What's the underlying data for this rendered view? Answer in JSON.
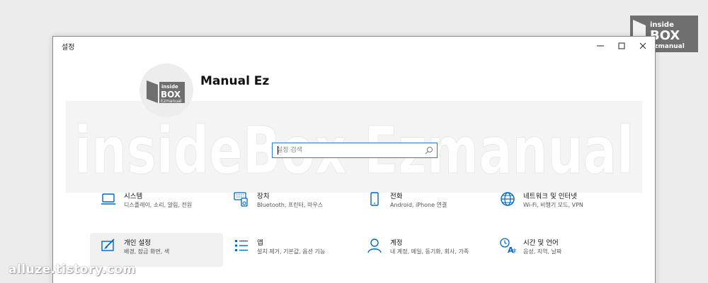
{
  "window": {
    "title": "설정",
    "minimize_glyph": "—",
    "maximize_glyph": "☐",
    "close_glyph": "✕"
  },
  "profile": {
    "name": "Manual Ez"
  },
  "search": {
    "placeholder": "설정 검색",
    "icon": "search-icon"
  },
  "watermark": {
    "band_text": "insideBox Ezmanual",
    "site": "alluze.tistory.com",
    "logo_lines": [
      "inside",
      "BOX",
      "Ezmanual"
    ]
  },
  "tiles": [
    {
      "label": "시스템",
      "desc": "디스플레이, 소리, 알림, 전원",
      "icon": "laptop-icon"
    },
    {
      "label": "장치",
      "desc": "Bluetooth, 프린터, 마우스",
      "icon": "keyboard-speaker-icon"
    },
    {
      "label": "전화",
      "desc": "Android, iPhone 연결",
      "icon": "phone-icon"
    },
    {
      "label": "네트워크 및 인터넷",
      "desc": "Wi-Fi, 비행기 모드, VPN",
      "icon": "globe-icon"
    },
    {
      "label": "개인 설정",
      "desc": "배경, 잠금 화면, 색",
      "icon": "personalization-icon"
    },
    {
      "label": "앱",
      "desc": "설치 제거, 기본값, 옵션 기능",
      "icon": "apps-list-icon"
    },
    {
      "label": "계정",
      "desc": "내 계정, 메일, 동기화, 회사, 가족",
      "icon": "person-icon"
    },
    {
      "label": "시간 및 언어",
      "desc": "음성, 지역, 날짜",
      "icon": "time-language-icon"
    }
  ],
  "colors": {
    "accent": "#0067c0",
    "search_border": "#2a7ad2",
    "active_tile": "#f0f0f0"
  }
}
